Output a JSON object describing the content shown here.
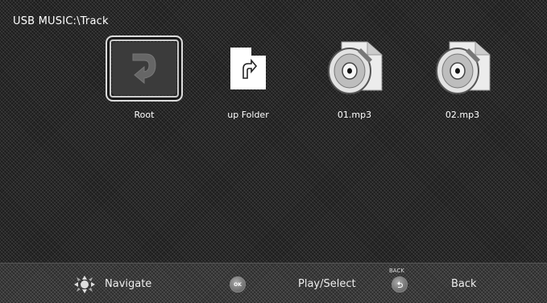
{
  "header": {
    "path": "USB MUSIC:\\Track"
  },
  "tiles": [
    {
      "label": "Root",
      "icon": "return-arrow-icon",
      "selected": true
    },
    {
      "label": "up Folder",
      "icon": "up-folder-icon",
      "selected": false
    },
    {
      "label": "01.mp3",
      "icon": "music-disc-icon",
      "selected": false
    },
    {
      "label": "02.mp3",
      "icon": "music-disc-icon",
      "selected": false
    }
  ],
  "footer": {
    "navigate_label": "Navigate",
    "ok_badge": "OK",
    "play_label": "Play/Select",
    "back_tag": "BACK",
    "back_label": "Back"
  }
}
